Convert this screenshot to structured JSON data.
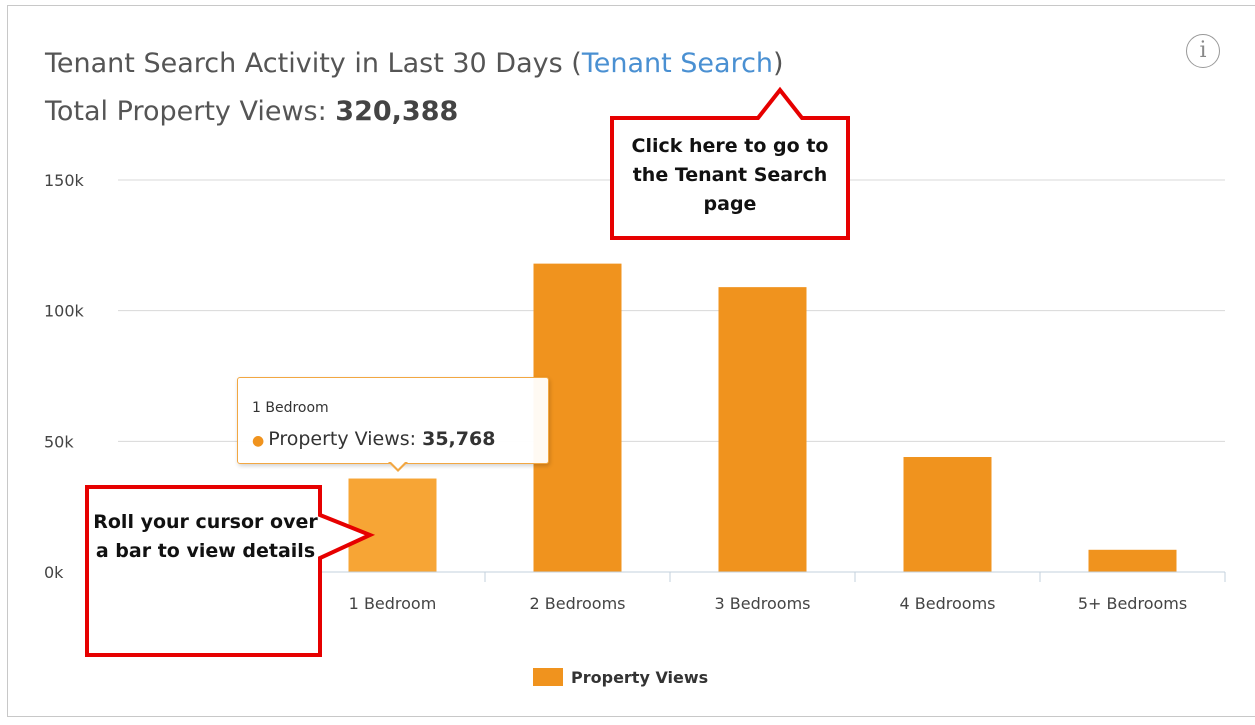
{
  "header": {
    "title": "Tenant Search Activity in Last 30 Days (",
    "title_link": "Tenant Search",
    "title_suffix": ")",
    "total_label": "Total Property Views: ",
    "total_value": "320,388"
  },
  "info_icon": {
    "icon": "info-icon",
    "glyph": "i"
  },
  "tooltip": {
    "category": "1 Bedroom",
    "series": "Property Views: ",
    "value": "35,768",
    "marker": "●"
  },
  "callouts": {
    "top": "Click here to go to the Tenant Search page",
    "left": "Roll your cursor over a bar to view details"
  },
  "colors": {
    "bar": "#f0931e",
    "bar_hover": "#f7a535",
    "grid": "#d8d8d8",
    "axis": "#c3d0dc",
    "callout_border": "#e60000",
    "link": "#4a90d2"
  },
  "chart_data": {
    "type": "bar",
    "categories": [
      "1 Bedroom",
      "2 Bedrooms",
      "3 Bedrooms",
      "4 Bedrooms",
      "5+ Bedrooms"
    ],
    "series": [
      {
        "name": "Property Views",
        "values": [
          35768,
          118000,
          109000,
          44000,
          8500
        ]
      }
    ],
    "ylim": [
      0,
      150000
    ],
    "yticks": [
      0,
      50000,
      100000,
      150000
    ],
    "ytick_labels": [
      "0k",
      "50k",
      "100k",
      "150k"
    ],
    "highlighted_category": "1 Bedroom",
    "grid": true,
    "legend": {
      "position": "bottom-center",
      "entries": [
        "Property Views"
      ]
    }
  }
}
